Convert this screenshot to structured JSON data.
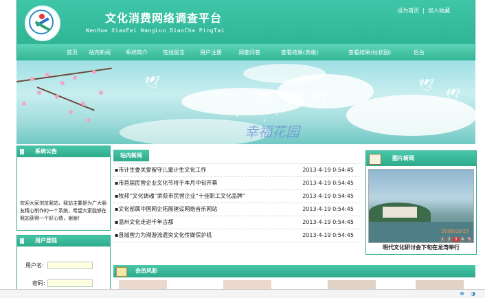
{
  "header": {
    "title": "文化消费网络调查平台",
    "subtitle": "WenHua XiaoFei WangLuo DiaoCha PingTai",
    "links": [
      "设为首页",
      "加入收藏"
    ],
    "link_separator": "|"
  },
  "nav": {
    "items": [
      "首页",
      "站内新闻",
      "系统简介",
      "在线留言",
      "用户注册",
      "调查问卷",
      "查看结果(表格)",
      "查看结果(柱状图)",
      "后台"
    ]
  },
  "banner": {
    "text": "幸福花园"
  },
  "notice": {
    "title": "系统公告",
    "text": "欢迎大家浏览我站，我站主要是为广大朋友精心制作的一个系统，希望大家能够在我站获得一个好心情，谢谢！"
  },
  "login": {
    "title": "用户登陆",
    "username_label": "用户名:",
    "password_label": "密码:",
    "username_value": "",
    "password_value": ""
  },
  "news": {
    "tab": "站内新闻",
    "items": [
      {
        "title": "市计生委关爱留守儿童计生文化工作",
        "date": "2013-4-19 0:54:45"
      },
      {
        "title": "市首届民营企业文化节将于本月中旬开幕",
        "date": "2013-4-19 0:54:45"
      },
      {
        "title": "牧邦“文化铸魂”荣获市民营企业“十佳职工文化品牌”",
        "date": "2013-4-19 0:54:45"
      },
      {
        "title": "文化部属中国网企拓展建设网络音乐网站",
        "date": "2013-4-19 0:54:45"
      },
      {
        "title": "温州文化走进千年古都",
        "date": "2013-4-19 0:54:45"
      },
      {
        "title": "县城营力为溯游流遗资文化传媒保护机",
        "date": "2013-4-19 0:54:45"
      }
    ]
  },
  "photo_news": {
    "title": "图片新闻",
    "caption": "明代文化研讨会下旬在龙湾举行",
    "image_date": "2006/10/27",
    "pager": [
      "1",
      "2",
      "3",
      "4",
      "5"
    ]
  },
  "members": {
    "title": "会员风彩"
  },
  "colors": {
    "teal": "#2ea98c",
    "teal_light": "#48c7a9"
  }
}
